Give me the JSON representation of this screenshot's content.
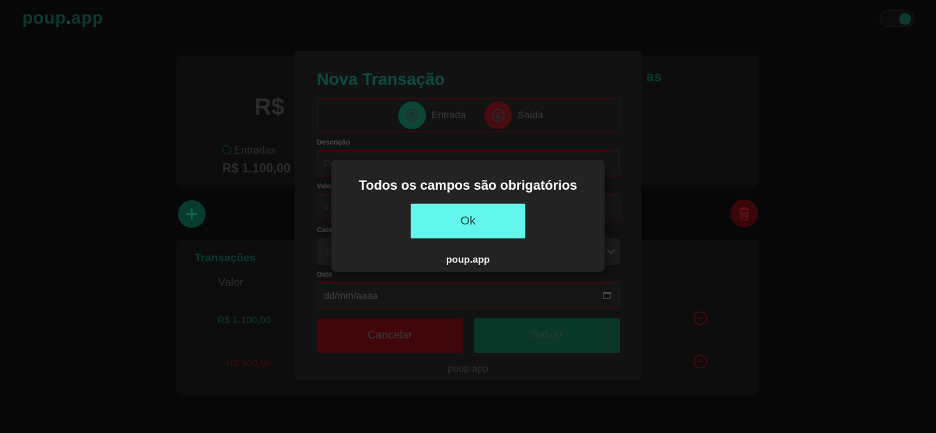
{
  "header": {
    "brand_prefix": "poup",
    "brand_dot": ".",
    "brand_suffix": "app"
  },
  "summary": {
    "balance_amount": "R$",
    "income_label": "Entradas",
    "income_value": "R$ 1.100,00",
    "hidden_heading_tail": "as"
  },
  "transactions": {
    "title": "Transações",
    "column_value": "Valor",
    "rows": [
      {
        "value": "R$ 1.100,00",
        "kind": "entrada"
      },
      {
        "value": "-R$ 500,00",
        "kind": "saida"
      }
    ]
  },
  "modal": {
    "title": "Nova Transação",
    "type_income": "Entrada",
    "type_expense": "Saída",
    "description_label": "Descrição",
    "description_placeholder": "De",
    "value_label": "Valo",
    "value_placeholder": "0,",
    "category_label": "Cate",
    "category_value": "C",
    "date_label": "Data",
    "date_placeholder": "dd/mm/aaaa",
    "cancel_label": "Cancelar",
    "save_label": "Salvar",
    "footer": "poup.app"
  },
  "alert": {
    "message": "Todos os campos são obrigatórios",
    "ok_label": "Ok",
    "footer": "poup.app"
  },
  "colors": {
    "accent": "#63f6ec",
    "income": "#0c4636",
    "expense": "#470b11",
    "dialog_bg": "#232323"
  }
}
